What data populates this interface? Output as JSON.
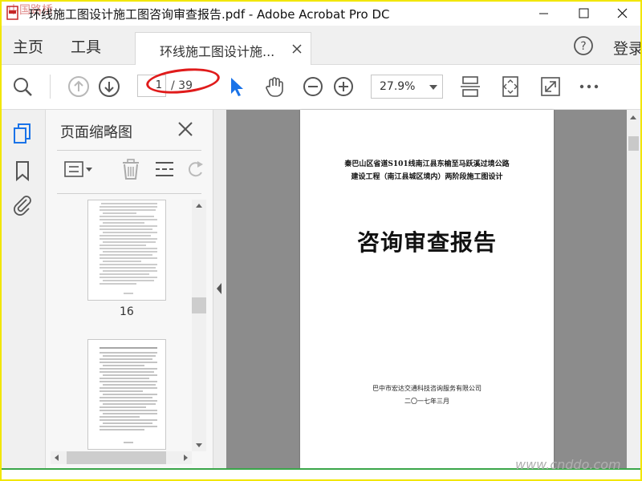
{
  "window": {
    "title": "环线施工图设计施工图咨询审查报告.pdf - Adobe Acrobat Pro DC"
  },
  "menu": {
    "home": "主页",
    "tools": "工具",
    "login": "登录"
  },
  "tab": {
    "label": "环线施工图设计施..."
  },
  "toolbar": {
    "page_current": "1",
    "page_total": "/ 39",
    "zoom": "27.9%"
  },
  "thumbnails": {
    "panel_title": "页面缩略图",
    "items": [
      {
        "page_label": "16"
      },
      {
        "page_label": ""
      }
    ]
  },
  "document": {
    "header_line1": "秦巴山区省道S101线南江县东榆至马跃溪过境公路",
    "header_line2": "建设工程（南江县城区境内）两阶段施工图设计",
    "title": "咨询审查报告",
    "company": "巴中市宏达交通科技咨询服务有限公司",
    "date": "二〇一七年三月"
  },
  "watermarks": {
    "bottom_right": "www.cnddo.com",
    "top_left": "中国路桥"
  },
  "colors": {
    "annotation_ring": "#e01b1b",
    "selection_arrow": "#1a73e8",
    "window_border": "#f2e600"
  }
}
